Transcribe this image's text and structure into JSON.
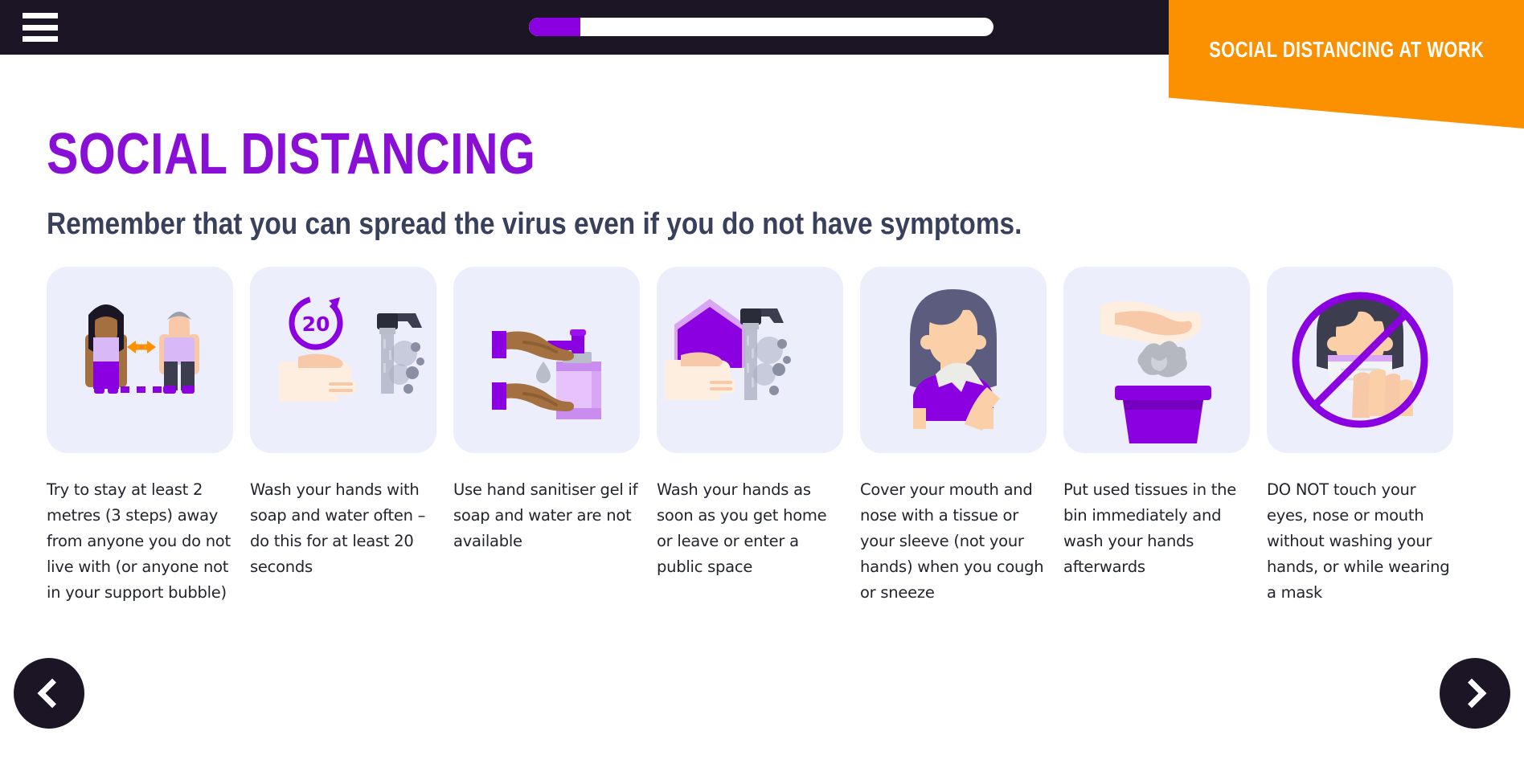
{
  "topbar": {
    "menu_icon": "hamburger-menu-icon",
    "progress_percent": 11,
    "progress_fill_color": "#8a00e0",
    "background_color": "#1b1525"
  },
  "banner": {
    "label": "Social distancing at work",
    "background_color": "#fb9001",
    "text_color": "#ffffff"
  },
  "page": {
    "title": "Social distancing",
    "title_color": "#8a0fd6",
    "subtitle": "Remember that you can spread the virus even if you do not have symptoms.",
    "subtitle_color": "#39405c",
    "tile_background": "#eceefc",
    "accent_purple": "#8a00e0"
  },
  "cards": [
    {
      "icon": "two-people-distance-icon",
      "caption": "Try to stay at least 2 metres (3 steps) away from anyone you do not live with (or anyone not in your support bubble)"
    },
    {
      "icon": "hand-washing-20-seconds-icon",
      "caption": "Wash your hands with soap and water often – do this for at least 20 seconds",
      "badge": "20"
    },
    {
      "icon": "hand-sanitiser-bottle-icon",
      "caption": "Use hand sanitiser gel if soap and water are not available"
    },
    {
      "icon": "wash-hands-at-home-icon",
      "caption": "Wash your hands as soon as you get home or leave or enter a public space"
    },
    {
      "icon": "cover-mouth-tissue-icon",
      "caption": "Cover your mouth and nose with a tissue or your sleeve (not your hands) when you cough or sneeze"
    },
    {
      "icon": "tissue-in-bin-icon",
      "caption": "Put used tissues in the bin immediately and wash your hands afterwards"
    },
    {
      "icon": "do-not-touch-face-icon",
      "caption": "DO NOT touch your eyes, nose or mouth without washing your hands, or while wearing a mask"
    }
  ],
  "nav": {
    "prev_label": "Previous slide",
    "next_label": "Next slide",
    "button_color": "#1b1525"
  }
}
